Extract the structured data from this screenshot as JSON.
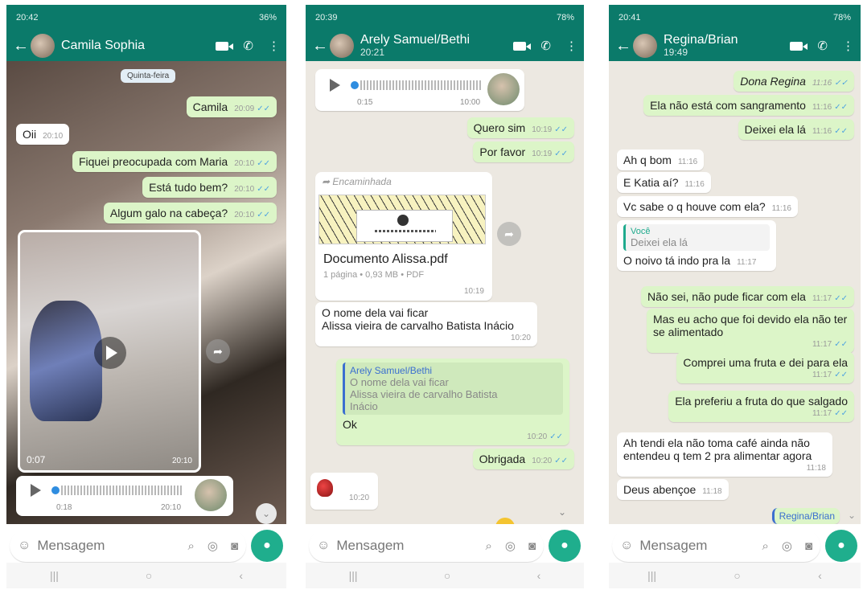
{
  "common": {
    "input_placeholder": "Mensagem"
  },
  "screens": [
    {
      "status": {
        "time": "20:42",
        "battery": "36%"
      },
      "header": {
        "title": "Camila Sophia"
      },
      "day_label": "Quinta-feira",
      "messages": [
        {
          "text": "Camila",
          "time": "20:09"
        },
        {
          "text": "Oii",
          "time": "20:10"
        },
        {
          "text": "Fiquei preocupada com Maria",
          "time": "20:10"
        },
        {
          "text": "Está tudo bem?",
          "time": "20:10"
        },
        {
          "text": "Algum galo na cabeça?",
          "time": "20:10"
        }
      ],
      "video": {
        "duration": "0:07",
        "time": "20:10"
      },
      "voice": {
        "duration": "0:18",
        "time": "20:10"
      }
    },
    {
      "status": {
        "time": "20:39",
        "battery": "78%"
      },
      "header": {
        "title": "Arely Samuel/Bethi",
        "subtitle": "20:21"
      },
      "voice": {
        "duration": "0:15",
        "time": "10:00"
      },
      "messages": [
        {
          "text": "Quero sim",
          "time": "10:19"
        },
        {
          "text": "Por favor",
          "time": "10:19"
        }
      ],
      "document": {
        "forwarded": "Encaminhada",
        "name": "Documento  Alissa.pdf",
        "meta": "1 página • 0,93 MB • PDF",
        "time": "10:19"
      },
      "name_msg": {
        "text": "O nome dela vai ficar\nAlissa vieira de carvalho Batista Inácio",
        "time": "10:20"
      },
      "reply": {
        "quoted_name": "Arely Samuel/Bethi",
        "quoted_text": "O nome dela vai ficar\nAlissa vieira de carvalho Batista\nInácio",
        "text": "Ok",
        "time": "10:20"
      },
      "thanks": {
        "text": "Obrigada",
        "time": "10:20"
      },
      "sticker_time": "10:20"
    },
    {
      "status": {
        "time": "20:41",
        "battery": "78%"
      },
      "header": {
        "title": "Regina/Brian",
        "subtitle": "19:49"
      },
      "messages": [
        {
          "text": "Dona Regina",
          "time": "11:16"
        },
        {
          "text": "Ela não está com sangramento",
          "time": "11:16"
        },
        {
          "text": "Deixei ela lá",
          "time": "11:16"
        },
        {
          "text": "Ah q bom",
          "time": "11:16"
        },
        {
          "text": "E Katia aí?",
          "time": "11:16"
        },
        {
          "text": "Vc sabe o q houve com ela?",
          "time": "11:16"
        }
      ],
      "reply": {
        "quoted_name": "Você",
        "quoted_text": "Deixei ela lá",
        "text": "O noivo tá indo pra la",
        "time": "11:17"
      },
      "messages2": [
        {
          "text": "Não sei, não pude ficar com ela",
          "time": "11:17"
        },
        {
          "text": "Mas eu acho que foi devido ela não ter\nse alimentado",
          "time": "11:17"
        },
        {
          "text": "Comprei uma fruta e dei para ela",
          "time": "11:17"
        },
        {
          "text": "Ela preferiu a fruta do que salgado",
          "time": "11:17"
        },
        {
          "text": "Ah tendi ela não toma café ainda não\nentendeu q tem 2 pra alimentar agora",
          "time": "11:18"
        },
        {
          "text": "Deus abençoe",
          "time": "11:18"
        }
      ],
      "last_reply_label": "Regina/Brian"
    }
  ]
}
